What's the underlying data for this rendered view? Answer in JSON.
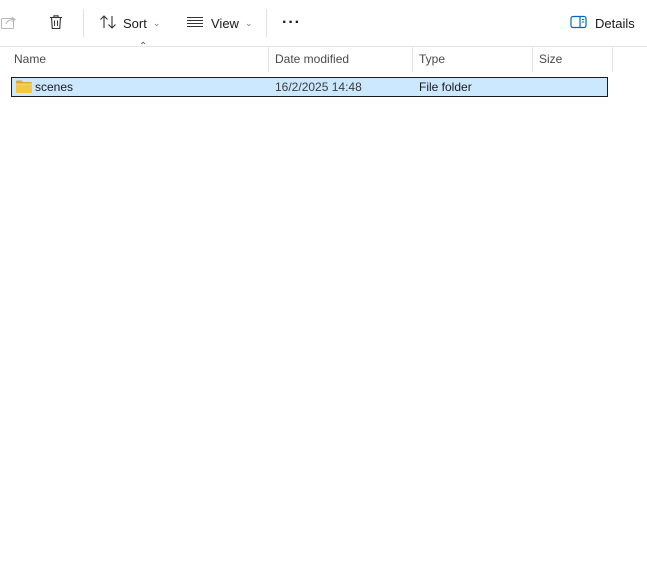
{
  "toolbar": {
    "share_icon": "share-icon",
    "delete_icon": "trash-icon",
    "sort_label": "Sort",
    "view_label": "View",
    "more_label": "···",
    "details_label": "Details"
  },
  "columns": [
    "Name",
    "Date modified",
    "Type",
    "Size"
  ],
  "rows": [
    {
      "icon": "folder-icon",
      "name": "scenes",
      "date_modified": "16/2/2025 14:48",
      "type": "File folder",
      "size": ""
    }
  ],
  "colors": {
    "selection_bg": "#cce8ff",
    "folder_yellow": "#f4c542",
    "accent": "#0067c0"
  }
}
